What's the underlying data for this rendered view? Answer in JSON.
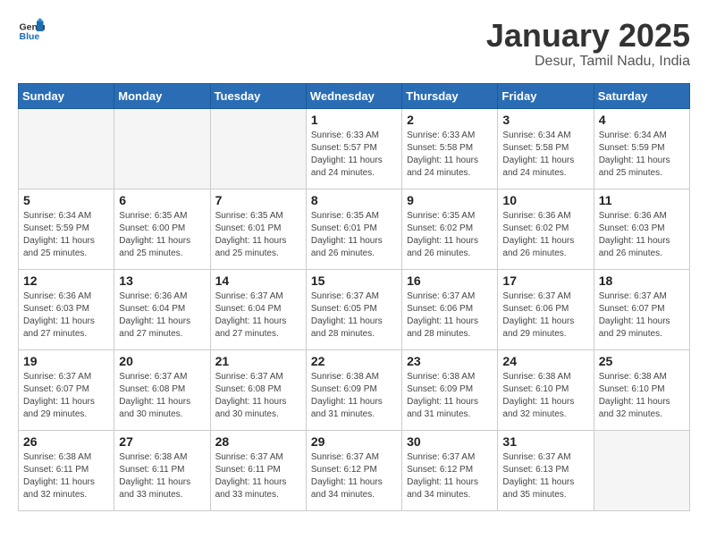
{
  "header": {
    "logo_general": "General",
    "logo_blue": "Blue",
    "month": "January 2025",
    "location": "Desur, Tamil Nadu, India"
  },
  "days_of_week": [
    "Sunday",
    "Monday",
    "Tuesday",
    "Wednesday",
    "Thursday",
    "Friday",
    "Saturday"
  ],
  "weeks": [
    [
      {
        "day": "",
        "info": ""
      },
      {
        "day": "",
        "info": ""
      },
      {
        "day": "",
        "info": ""
      },
      {
        "day": "1",
        "info": "Sunrise: 6:33 AM\nSunset: 5:57 PM\nDaylight: 11 hours\nand 24 minutes."
      },
      {
        "day": "2",
        "info": "Sunrise: 6:33 AM\nSunset: 5:58 PM\nDaylight: 11 hours\nand 24 minutes."
      },
      {
        "day": "3",
        "info": "Sunrise: 6:34 AM\nSunset: 5:58 PM\nDaylight: 11 hours\nand 24 minutes."
      },
      {
        "day": "4",
        "info": "Sunrise: 6:34 AM\nSunset: 5:59 PM\nDaylight: 11 hours\nand 25 minutes."
      }
    ],
    [
      {
        "day": "5",
        "info": "Sunrise: 6:34 AM\nSunset: 5:59 PM\nDaylight: 11 hours\nand 25 minutes."
      },
      {
        "day": "6",
        "info": "Sunrise: 6:35 AM\nSunset: 6:00 PM\nDaylight: 11 hours\nand 25 minutes."
      },
      {
        "day": "7",
        "info": "Sunrise: 6:35 AM\nSunset: 6:01 PM\nDaylight: 11 hours\nand 25 minutes."
      },
      {
        "day": "8",
        "info": "Sunrise: 6:35 AM\nSunset: 6:01 PM\nDaylight: 11 hours\nand 26 minutes."
      },
      {
        "day": "9",
        "info": "Sunrise: 6:35 AM\nSunset: 6:02 PM\nDaylight: 11 hours\nand 26 minutes."
      },
      {
        "day": "10",
        "info": "Sunrise: 6:36 AM\nSunset: 6:02 PM\nDaylight: 11 hours\nand 26 minutes."
      },
      {
        "day": "11",
        "info": "Sunrise: 6:36 AM\nSunset: 6:03 PM\nDaylight: 11 hours\nand 26 minutes."
      }
    ],
    [
      {
        "day": "12",
        "info": "Sunrise: 6:36 AM\nSunset: 6:03 PM\nDaylight: 11 hours\nand 27 minutes."
      },
      {
        "day": "13",
        "info": "Sunrise: 6:36 AM\nSunset: 6:04 PM\nDaylight: 11 hours\nand 27 minutes."
      },
      {
        "day": "14",
        "info": "Sunrise: 6:37 AM\nSunset: 6:04 PM\nDaylight: 11 hours\nand 27 minutes."
      },
      {
        "day": "15",
        "info": "Sunrise: 6:37 AM\nSunset: 6:05 PM\nDaylight: 11 hours\nand 28 minutes."
      },
      {
        "day": "16",
        "info": "Sunrise: 6:37 AM\nSunset: 6:06 PM\nDaylight: 11 hours\nand 28 minutes."
      },
      {
        "day": "17",
        "info": "Sunrise: 6:37 AM\nSunset: 6:06 PM\nDaylight: 11 hours\nand 29 minutes."
      },
      {
        "day": "18",
        "info": "Sunrise: 6:37 AM\nSunset: 6:07 PM\nDaylight: 11 hours\nand 29 minutes."
      }
    ],
    [
      {
        "day": "19",
        "info": "Sunrise: 6:37 AM\nSunset: 6:07 PM\nDaylight: 11 hours\nand 29 minutes."
      },
      {
        "day": "20",
        "info": "Sunrise: 6:37 AM\nSunset: 6:08 PM\nDaylight: 11 hours\nand 30 minutes."
      },
      {
        "day": "21",
        "info": "Sunrise: 6:37 AM\nSunset: 6:08 PM\nDaylight: 11 hours\nand 30 minutes."
      },
      {
        "day": "22",
        "info": "Sunrise: 6:38 AM\nSunset: 6:09 PM\nDaylight: 11 hours\nand 31 minutes."
      },
      {
        "day": "23",
        "info": "Sunrise: 6:38 AM\nSunset: 6:09 PM\nDaylight: 11 hours\nand 31 minutes."
      },
      {
        "day": "24",
        "info": "Sunrise: 6:38 AM\nSunset: 6:10 PM\nDaylight: 11 hours\nand 32 minutes."
      },
      {
        "day": "25",
        "info": "Sunrise: 6:38 AM\nSunset: 6:10 PM\nDaylight: 11 hours\nand 32 minutes."
      }
    ],
    [
      {
        "day": "26",
        "info": "Sunrise: 6:38 AM\nSunset: 6:11 PM\nDaylight: 11 hours\nand 32 minutes."
      },
      {
        "day": "27",
        "info": "Sunrise: 6:38 AM\nSunset: 6:11 PM\nDaylight: 11 hours\nand 33 minutes."
      },
      {
        "day": "28",
        "info": "Sunrise: 6:37 AM\nSunset: 6:11 PM\nDaylight: 11 hours\nand 33 minutes."
      },
      {
        "day": "29",
        "info": "Sunrise: 6:37 AM\nSunset: 6:12 PM\nDaylight: 11 hours\nand 34 minutes."
      },
      {
        "day": "30",
        "info": "Sunrise: 6:37 AM\nSunset: 6:12 PM\nDaylight: 11 hours\nand 34 minutes."
      },
      {
        "day": "31",
        "info": "Sunrise: 6:37 AM\nSunset: 6:13 PM\nDaylight: 11 hours\nand 35 minutes."
      },
      {
        "day": "",
        "info": ""
      }
    ]
  ]
}
